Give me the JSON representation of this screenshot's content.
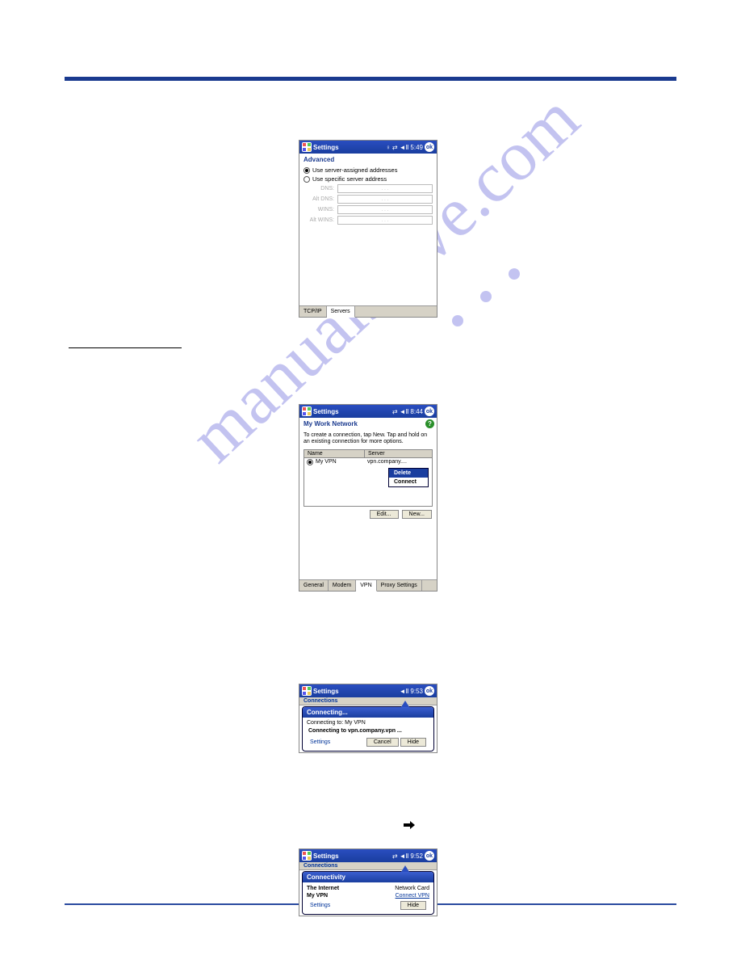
{
  "watermark": "manualshive.com",
  "screen1": {
    "title": "Settings",
    "tray": {
      "time": "5:49",
      "ok": "ok",
      "signal": "⇄",
      "sound": "◄Ⅱ",
      "ant": "♀"
    },
    "section": "Advanced",
    "radio_assigned": "Use server-assigned addresses",
    "radio_specific": "Use specific server address",
    "fields": {
      "dns": "DNS:",
      "altdns": "Alt DNS:",
      "wins": "WINS:",
      "altwins": "Alt WINS:"
    },
    "ip_sep": ". . .",
    "tabs": {
      "tcpip": "TCP/IP",
      "servers": "Servers"
    }
  },
  "instructions_label": " ",
  "screen2": {
    "title": "Settings",
    "tray": {
      "time": "8:44",
      "ok": "ok",
      "signal": "⇄",
      "sound": "◄Ⅱ"
    },
    "help": "?",
    "section": "My Work Network",
    "msg": "To create a connection, tap New. Tap and hold on an existing connection for more options.",
    "cols": {
      "name": "Name",
      "server": "Server"
    },
    "row": {
      "name": "My VPN",
      "server": "vpn.company...."
    },
    "ctx": {
      "delete": "Delete",
      "connect": "Connect"
    },
    "buttons": {
      "edit": "Edit...",
      "new": "New..."
    },
    "tabs": {
      "general": "General",
      "modem": "Modem",
      "vpn": "VPN",
      "proxy": "Proxy Settings"
    }
  },
  "screen3": {
    "title": "Settings",
    "tray": {
      "time": "9:53",
      "ok": "ok",
      "sound": "◄Ⅱ"
    },
    "strip": "Connections",
    "bubble_title": "Connecting...",
    "line1": "Connecting to: My VPN",
    "line2": "Connecting to vpn.company.vpn ...",
    "settings": "Settings",
    "buttons": {
      "cancel": "Cancel",
      "hide": "Hide"
    }
  },
  "conn_icon": "↔",
  "screen4": {
    "title": "Settings",
    "tray": {
      "time": "9:52",
      "ok": "ok",
      "signal": "⇄",
      "sound": "◄Ⅱ"
    },
    "strip": "Connections",
    "bubble_title": "Connectivity",
    "rows": {
      "r1_left": "The Internet",
      "r1_right": "Network Card",
      "r2_left": "My VPN",
      "r2_right": "Connect VPN"
    },
    "settings": "Settings",
    "hide": "Hide"
  }
}
